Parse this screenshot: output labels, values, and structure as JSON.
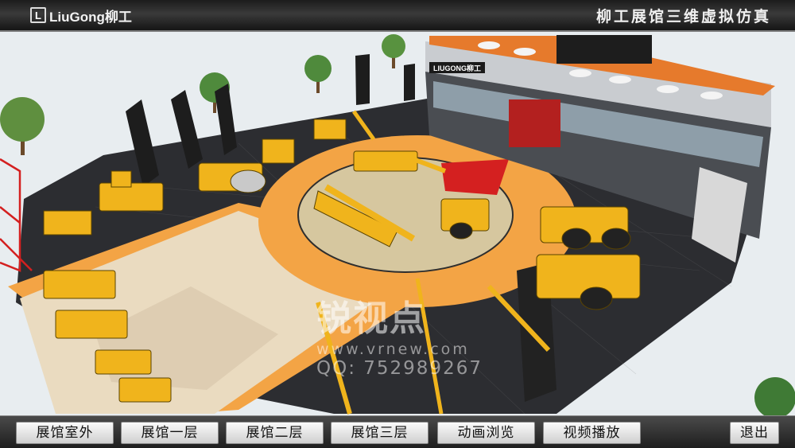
{
  "header": {
    "logo_mark": "L",
    "logo_text": "LiuGong柳工",
    "title": "柳工展馆三维虚拟仿真"
  },
  "scene": {
    "building_sign": "LIUGONG柳工",
    "watermark": {
      "title": "锐视点",
      "url": "www.vrnew.com",
      "qq": "QQ: 752989267"
    }
  },
  "nav": {
    "buttons": [
      {
        "label": "展馆室外"
      },
      {
        "label": "展馆一层"
      },
      {
        "label": "展馆二层"
      },
      {
        "label": "展馆三层"
      },
      {
        "label": "动画浏览"
      },
      {
        "label": "视频播放"
      }
    ],
    "exit_label": "退出"
  },
  "colors": {
    "machine_yellow": "#f0b41c",
    "floor_orange": "#f0a040",
    "dark_floor": "#2f2f33",
    "red_accent": "#d42020"
  }
}
